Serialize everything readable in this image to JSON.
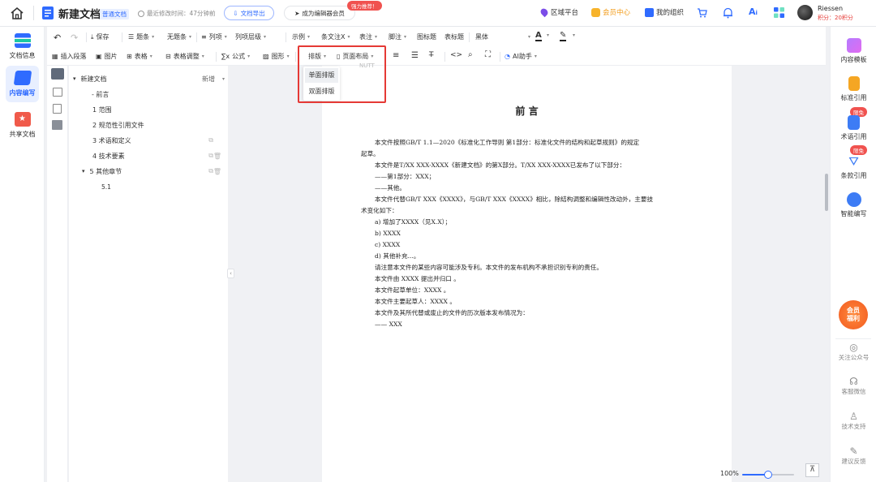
{
  "topbar": {
    "doc_title": "新建文档",
    "doc_type_badge": "普通文档",
    "last_modified": "最近修改时间：47分钟前",
    "export_button": "文档导出",
    "member_button": "成为编辑器会员",
    "promo_badge": "强力推荐！",
    "region_platform": "区域平台",
    "vip_center": "会员中心",
    "my_org": "我的组织",
    "username": "Riessen",
    "points": "积分：20积分"
  },
  "leftnav": {
    "items": [
      {
        "label": "文档信息"
      },
      {
        "label": "内容编写"
      },
      {
        "label": "共享文档"
      }
    ]
  },
  "toolbar": {
    "row1": {
      "save": "保存",
      "title_item": "题条",
      "no_title_item": "无题条",
      "list": "列项",
      "list_level": "列项层级",
      "example": "示例",
      "item_text": "条文注X",
      "table_note": "表注",
      "footnote": "脚注",
      "figure_title": "图标题",
      "table_title": "表标题",
      "font": "黑体"
    },
    "row2": {
      "insert_paragraph": "插入段落",
      "image": "图片",
      "table": "表格",
      "table_adjust": "表格调整",
      "formula": "公式",
      "shape": "图形",
      "layout": "排版",
      "page_layout": "页面布局",
      "ai_assistant": "AI助手"
    }
  },
  "dropdown": {
    "options": [
      "单面排版",
      "双面排版"
    ]
  },
  "outline": {
    "root": "新建文档",
    "new_button": "新增",
    "items": [
      {
        "label": "- 前言"
      },
      {
        "label": "1 范围"
      },
      {
        "label": "2 规范性引用文件"
      },
      {
        "label": "3 术语和定义"
      },
      {
        "label": "4 技术要素"
      },
      {
        "label": "5 其他章节"
      },
      {
        "label": "5.1"
      }
    ]
  },
  "document": {
    "header_placeholder": "NUTT",
    "heading": "前  言",
    "lines": [
      "本文件按照GB/T 1.1—2020《标准化工作导则 第1部分：标准化文件的结构和起草规则》的规定",
      "起草。",
      "本文件是T/XX XXX-XXXX《新建文档》的第X部分。T/XX XXX-XXXX已发布了以下部分：",
      "——第1部分：XXX；",
      "——其他。",
      "本文件代替GB/T XXX《XXXX》，与GB/T XXX《XXXX》相比，除结构调整和编辑性改动外，主要技",
      "术变化如下：",
      "a)   增加了XXXX（见X.X）；",
      "b)   XXXX",
      "c)   XXXX",
      "d)   其他补充...。",
      "请注意本文件的某些内容可能涉及专利。本文件的发布机构不承担识别专利的责任。",
      "本文件由 XXXX 提出并归口 。",
      "本文件起草单位：XXXX 。",
      "本文件主要起草人：XXXX 。",
      "本文件及其所代替或废止的文件的历次版本发布情况为：",
      "—— XXX"
    ]
  },
  "rightpanel": {
    "items": [
      {
        "label": "内容模板"
      },
      {
        "label": "标准引用"
      },
      {
        "label": "术语引用"
      },
      {
        "label": "条款引用"
      },
      {
        "label": "智能编写"
      }
    ],
    "limited_badge": "限免",
    "vip_benefit": "会员福利",
    "support": [
      {
        "label": "关注公众号"
      },
      {
        "label": "客服微信"
      },
      {
        "label": "技术支持"
      },
      {
        "label": "建议反馈"
      }
    ]
  },
  "zoom": {
    "level": "100%",
    "fraction": 0.5
  },
  "colors": {
    "accent": "#2f6bff",
    "highlight": "#e53935",
    "vip_orange": "#f29b18"
  }
}
